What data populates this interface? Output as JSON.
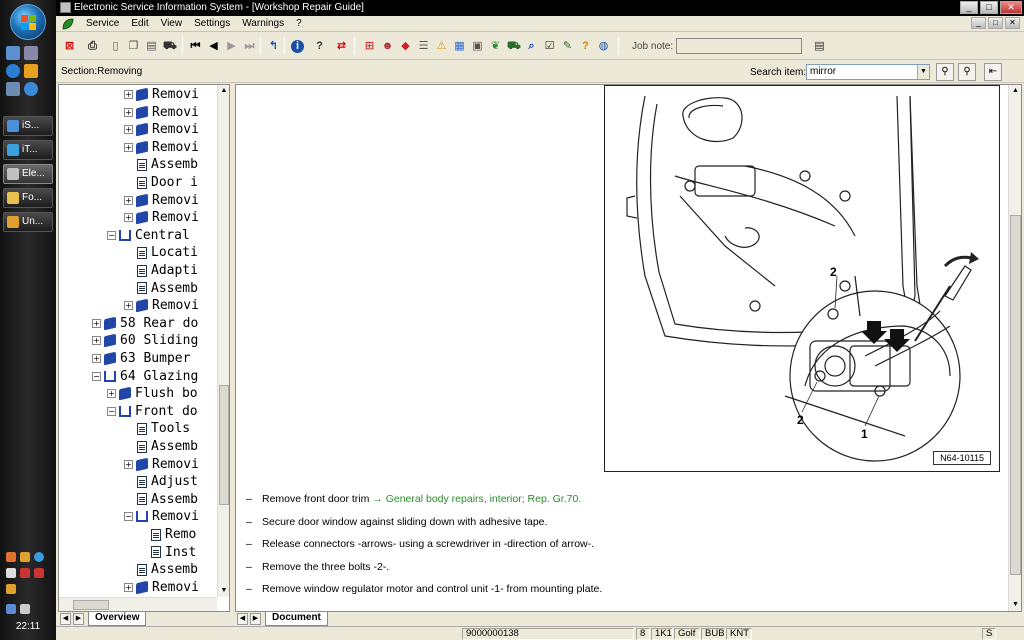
{
  "window": {
    "title": "Electronic Service Information System - [Workshop Repair Guide]",
    "minimize": "_",
    "maximize": "□",
    "close": "✕"
  },
  "taskbar": {
    "buttons": [
      {
        "label": "iS...",
        "color": "#4a8fd8"
      },
      {
        "label": "iT...",
        "color": "#3aa0e0"
      },
      {
        "label": "Ele...",
        "color": "#c0c0c0"
      },
      {
        "label": "Fo...",
        "color": "#e8c050"
      },
      {
        "label": "Un...",
        "color": "#e0a030"
      }
    ],
    "clock": "22:11"
  },
  "menu": {
    "items": [
      "Service",
      "Edit",
      "View",
      "Settings",
      "Warnings",
      "?"
    ]
  },
  "toolbar": {
    "job_note_label": "Job note:",
    "job_note_value": ""
  },
  "section": {
    "label": "Section:Removing",
    "search_label": "Search item:",
    "search_value": "mirror"
  },
  "tree": {
    "nodes": [
      {
        "label": "Removi",
        "icon": "book",
        "expander": "+",
        "level": 3
      },
      {
        "label": "Removi",
        "icon": "book",
        "expander": "+",
        "level": 3
      },
      {
        "label": "Removi",
        "icon": "book",
        "expander": "+",
        "level": 3
      },
      {
        "label": "Removi",
        "icon": "book",
        "expander": "+",
        "level": 3
      },
      {
        "label": "Assemb",
        "icon": "doc",
        "expander": "",
        "level": 3
      },
      {
        "label": "Door i",
        "icon": "doc",
        "expander": "",
        "level": 3
      },
      {
        "label": "Removi",
        "icon": "book",
        "expander": "+",
        "level": 3
      },
      {
        "label": "Removi",
        "icon": "book",
        "expander": "+",
        "level": 3
      },
      {
        "label": "Central",
        "icon": "openbook",
        "expander": "−",
        "level": 2
      },
      {
        "label": "Locati",
        "icon": "doc",
        "expander": "",
        "level": 3
      },
      {
        "label": "Adapti",
        "icon": "doc",
        "expander": "",
        "level": 3
      },
      {
        "label": "Assemb",
        "icon": "doc",
        "expander": "",
        "level": 3
      },
      {
        "label": "Removi",
        "icon": "book",
        "expander": "+",
        "level": 3
      },
      {
        "label": "58 Rear do",
        "icon": "book",
        "expander": "+",
        "level": 1
      },
      {
        "label": "60 Sliding",
        "icon": "book",
        "expander": "+",
        "level": 1
      },
      {
        "label": "63 Bumper",
        "icon": "book",
        "expander": "+",
        "level": 1
      },
      {
        "label": "64 Glazing",
        "icon": "openbook",
        "expander": "−",
        "level": 1
      },
      {
        "label": "Flush bo",
        "icon": "book",
        "expander": "+",
        "level": 2
      },
      {
        "label": "Front do",
        "icon": "openbook",
        "expander": "−",
        "level": 2
      },
      {
        "label": "Tools",
        "icon": "doc",
        "expander": "",
        "level": 3
      },
      {
        "label": "Assemb",
        "icon": "doc",
        "expander": "",
        "level": 3
      },
      {
        "label": "Removi",
        "icon": "book",
        "expander": "+",
        "level": 3
      },
      {
        "label": "Adjust",
        "icon": "doc",
        "expander": "",
        "level": 3
      },
      {
        "label": "Assemb",
        "icon": "doc",
        "expander": "",
        "level": 3
      },
      {
        "label": "Removi",
        "icon": "openbook",
        "expander": "−",
        "level": 3
      },
      {
        "label": "Remo",
        "icon": "doc",
        "expander": "",
        "level": 4,
        "selected": true
      },
      {
        "label": "Inst",
        "icon": "doc",
        "expander": "",
        "level": 4
      },
      {
        "label": "Assemb",
        "icon": "doc",
        "expander": "",
        "level": 3
      },
      {
        "label": "Removi",
        "icon": "book",
        "expander": "+",
        "level": 3
      }
    ],
    "tab_label": "Overview"
  },
  "document": {
    "figure_id": "N64-10115",
    "callouts": {
      "c1": "1",
      "c2a": "2",
      "c2b": "2"
    },
    "steps": [
      {
        "text": "Remove front door trim ",
        "link": "→ General body repairs, interior; Rep. Gr.70."
      },
      {
        "text": "Secure door window against sliding down with adhesive tape.",
        "link": ""
      },
      {
        "text": "Release connectors -arrows- using a screwdriver in -direction of arrow-.",
        "link": ""
      },
      {
        "text": "Remove the three bolts -2-.",
        "link": ""
      },
      {
        "text": "Remove window regulator motor and control unit -1- from mounting plate.",
        "link": ""
      }
    ],
    "dash": "–",
    "tab_label": "Document"
  },
  "status": {
    "cells": [
      "9000000138",
      "8",
      "1K1",
      "Golf",
      "BUB",
      "KNT",
      "S"
    ]
  }
}
